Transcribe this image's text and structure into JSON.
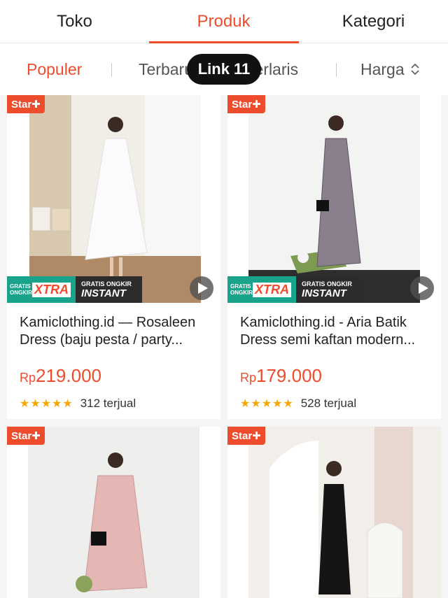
{
  "tabs": [
    {
      "label": "Toko"
    },
    {
      "label": "Produk"
    },
    {
      "label": "Kategori"
    }
  ],
  "sort": {
    "populer": "Populer",
    "terbaru": "Terbaru",
    "terlaris": "Terlaris",
    "harga": "Harga"
  },
  "overlay": {
    "label": "Link 11"
  },
  "colors": {
    "accent": "#ee4d2d",
    "promo_green": "#19a38b",
    "star": "#f6a700"
  },
  "products": [
    {
      "badge": "Star+",
      "promo_small": "GRATIS ONGKIR",
      "promo_big": "XTRA",
      "instant_small": "GRATIS ONGKIR",
      "instant_big": "INSTANT",
      "title": "Kamiclothing.id — Rosaleen Dress (baju pesta / party...",
      "currency": "Rp",
      "price": "219.000",
      "rating": 4.5,
      "sold": "312 terjual"
    },
    {
      "badge": "Star+",
      "promo_small": "GRATIS ONGKIR",
      "promo_big": "XTRA",
      "instant_small": "GRATIS ONGKIR",
      "instant_big": "INSTANT",
      "title": "Kamiclothing.id - Aria Batik Dress semi kaftan modern...",
      "currency": "Rp",
      "price": "179.000",
      "rating": 4.5,
      "sold": "528 terjual"
    },
    {
      "badge": "Star+"
    },
    {
      "badge": "Star+"
    }
  ]
}
